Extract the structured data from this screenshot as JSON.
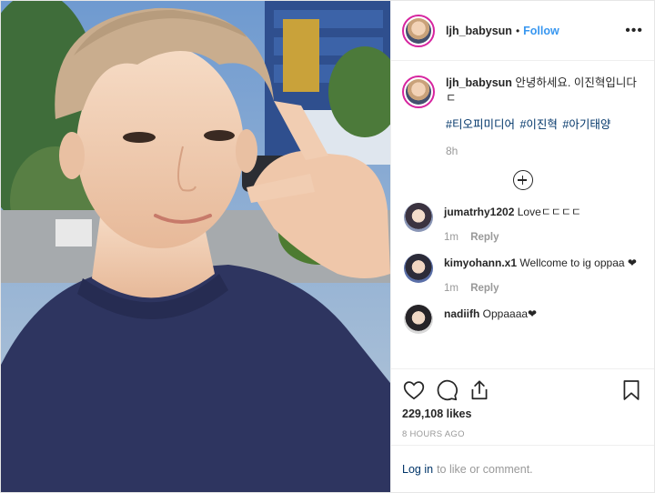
{
  "post": {
    "username": "ljh_babysun",
    "dot": "•",
    "follow_label": "Follow",
    "more_label": "•••"
  },
  "caption": {
    "username": "ljh_babysun",
    "text": "안녕하세요. 이진혁입니다ㄷ",
    "hashtags": [
      "#티오피미디어",
      "#이진혁",
      "#아기태양"
    ],
    "time": "8h"
  },
  "comments": [
    {
      "username": "jumatrhy1202",
      "text": "Loveㄷㄷㄷㄷ",
      "time": "1m",
      "reply_label": "Reply"
    },
    {
      "username": "kimyohann.x1",
      "text": "Wellcome to ig oppaa ❤",
      "time": "1m",
      "reply_label": "Reply"
    },
    {
      "username": "nadiifh",
      "text": "Oppaaaa❤",
      "time": "",
      "reply_label": ""
    }
  ],
  "actions": {
    "likes": "229,108 likes",
    "age": "8 HOURS AGO"
  },
  "login_bar": {
    "link": "Log in",
    "text": "to like or comment."
  },
  "icons": {
    "like": "heart-icon",
    "comment": "comment-icon",
    "share": "share-icon",
    "save": "bookmark-icon",
    "load_more": "plus-circle-icon"
  },
  "colors": {
    "link_blue": "#3897f0",
    "hashtag": "#003569",
    "muted": "#999999",
    "story_ring": "#d6249f"
  }
}
